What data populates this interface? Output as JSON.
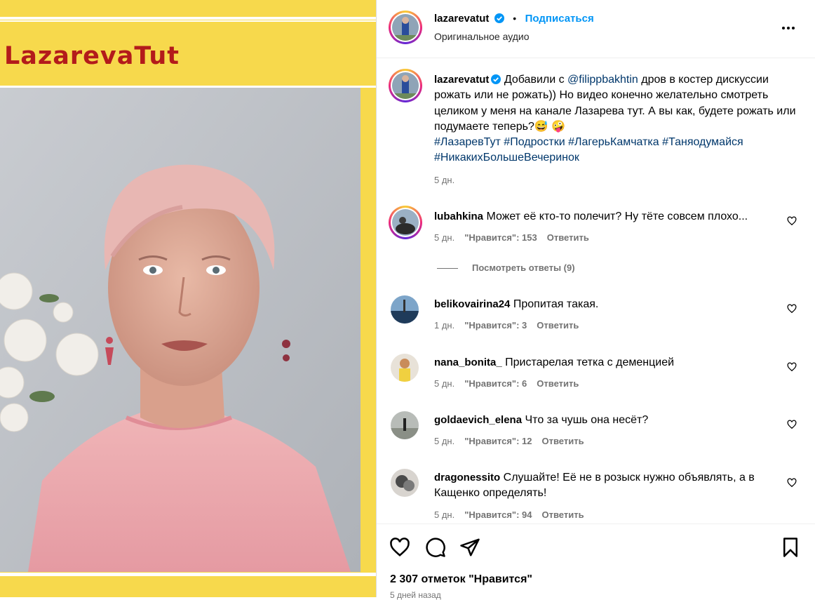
{
  "video": {
    "brand_text": "LazarevaTut"
  },
  "header": {
    "username": "lazarevatut",
    "separator": "•",
    "follow_label": "Подписаться",
    "audio": "Оригинальное аудио"
  },
  "caption": {
    "username": "lazarevatut",
    "text_before": "Добавили с ",
    "mention": "@filippbakhtin",
    "text_after": " дров в костер дискуссии рожать или не рожать)) Но видео конечно желательно смотреть целиком у меня на канале Лазарева тут. А вы как, будете рожать или подумаете теперь?😅 🤪",
    "hashtags": "#ЛазаревТут #Подростки #ЛагерьКамчатка #Таняодумайся #НикакихБольшеВечеринок",
    "time": "5 дн."
  },
  "comments": [
    {
      "username": "lubahkina",
      "text": "Может её кто-то полечит? Ну тёте совсем плохо...",
      "time": "5 дн.",
      "likes": "\"Нравится\": 153",
      "reply": "Ответить"
    },
    {
      "username": "belikovairina24",
      "text": "Пропитая такая.",
      "time": "1 дн.",
      "likes": "\"Нравится\": 3",
      "reply": "Ответить"
    },
    {
      "username": "nana_bonita_",
      "text": "Пристарелая тетка с деменцией",
      "time": "5 дн.",
      "likes": "\"Нравится\": 6",
      "reply": "Ответить"
    },
    {
      "username": "goldaevich_elena",
      "text": "Что за чушь она несёт?",
      "time": "5 дн.",
      "likes": "\"Нравится\": 12",
      "reply": "Ответить"
    },
    {
      "username": "dragonessito",
      "text": "Слушайте! Её не в розыск нужно объявлять, а в Кащенко определять!",
      "time": "5 дн.",
      "likes": "\"Нравится\": 94",
      "reply": "Ответить"
    }
  ],
  "view_replies": "Посмотреть ответы (9)",
  "footer": {
    "likes_count": "2 307 отметок \"Нравится\"",
    "posted": "5 дней назад"
  },
  "icons": [
    "more-icon",
    "verified-icon",
    "heart-icon",
    "comment-icon",
    "share-icon",
    "bookmark-icon"
  ],
  "colors": {
    "accent": "#0095f6",
    "brand_yellow": "#f7d94c",
    "brand_red": "#b31b1b",
    "muted": "#737373"
  }
}
